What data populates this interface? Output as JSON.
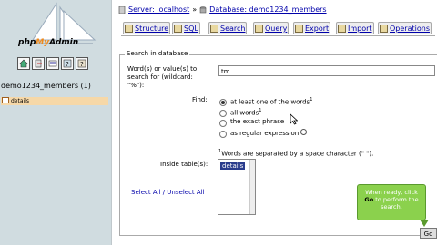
{
  "app": {
    "logo_left": "php",
    "logo_mid": "My",
    "logo_right": "Admin"
  },
  "sidebar": {
    "db_label": "demo1234_members (1)",
    "table_item": "details"
  },
  "breadcrumb": {
    "server": "Server: localhost",
    "database": "Database: demo1234_members"
  },
  "tabs": [
    "Structure",
    "SQL",
    "Search",
    "Query",
    "Export",
    "Import",
    "Operations"
  ],
  "form": {
    "legend": "Search in database",
    "words_label_1": "Word(s) or value(s) to",
    "words_label_2": "search for (wildcard:",
    "words_label_3": "\"%\"):",
    "words_value": "tm",
    "find_label": "Find:",
    "options": [
      "at least one of the words",
      "all words",
      "the exact phrase",
      "as regular expression"
    ],
    "footnote": "Words are separated by a space character (\" \").",
    "inside_label": "Inside table(s):",
    "table_option": "details",
    "select_links": "Select All / Unselect All",
    "go_label": "Go"
  },
  "tooltip": {
    "line1": "When ready, click",
    "go": "Go",
    "line2": " to perform the",
    "line3": "search."
  }
}
